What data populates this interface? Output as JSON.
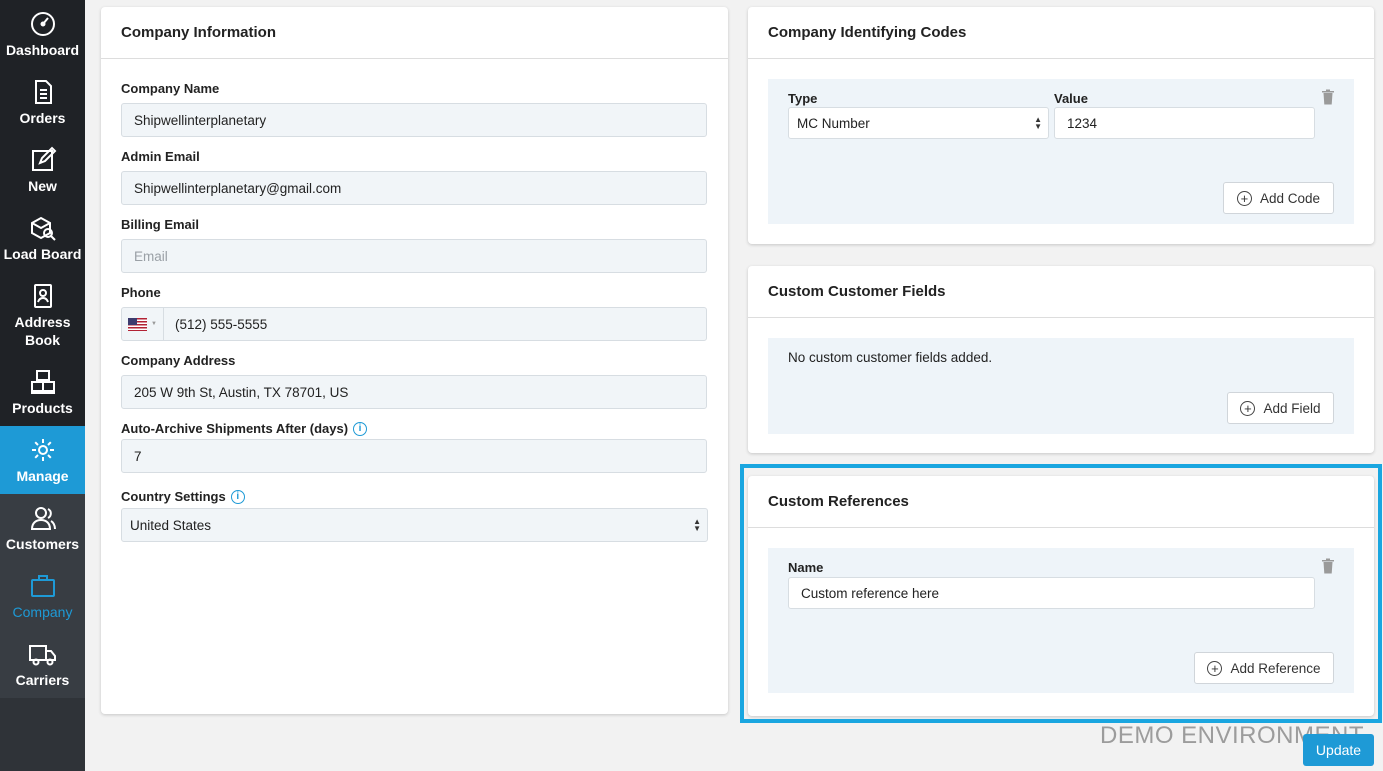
{
  "sidebar": {
    "items": [
      {
        "label": "Dashboard",
        "icon": "speedometer-icon"
      },
      {
        "label": "Orders",
        "icon": "document-list-icon"
      },
      {
        "label": "New",
        "icon": "edit-icon"
      },
      {
        "label": "Load Board",
        "icon": "box-search-icon"
      },
      {
        "label": "Address Book",
        "icon": "address-book-icon"
      },
      {
        "label": "Products",
        "icon": "boxes-icon"
      },
      {
        "label": "Manage",
        "icon": "gear-icon"
      },
      {
        "label": "Customers",
        "icon": "users-icon"
      },
      {
        "label": "Company",
        "icon": "briefcase-icon"
      },
      {
        "label": "Carriers",
        "icon": "truck-icon"
      }
    ]
  },
  "company_info": {
    "title": "Company Information",
    "company_name_label": "Company Name",
    "company_name": "Shipwellinterplanetary",
    "admin_email_label": "Admin Email",
    "admin_email": "Shipwellinterplanetary@gmail.com",
    "billing_email_label": "Billing Email",
    "billing_email_placeholder": "Email",
    "phone_label": "Phone",
    "phone": "(512) 555-5555",
    "address_label": "Company Address",
    "address": "205 W 9th St, Austin, TX 78701, US",
    "auto_archive_label": "Auto-Archive Shipments After (days)",
    "auto_archive": "7",
    "country_label": "Country Settings",
    "country": "United States"
  },
  "codes": {
    "title": "Company Identifying Codes",
    "type_label": "Type",
    "type_value": "MC Number",
    "value_label": "Value",
    "value": "1234",
    "add_label": "Add Code"
  },
  "custom_fields": {
    "title": "Custom Customer Fields",
    "empty_text": "No custom customer fields added.",
    "add_label": "Add Field"
  },
  "custom_refs": {
    "title": "Custom References",
    "name_label": "Name",
    "name_value": "Custom reference here",
    "add_label": "Add Reference"
  },
  "footer": {
    "demo_text": "DEMO ENVIRONMENT",
    "update_label": "Update"
  },
  "colors": {
    "accent": "#1e9ad6",
    "sidebar": "#2f3338",
    "highlight": "#1aa6e0"
  }
}
